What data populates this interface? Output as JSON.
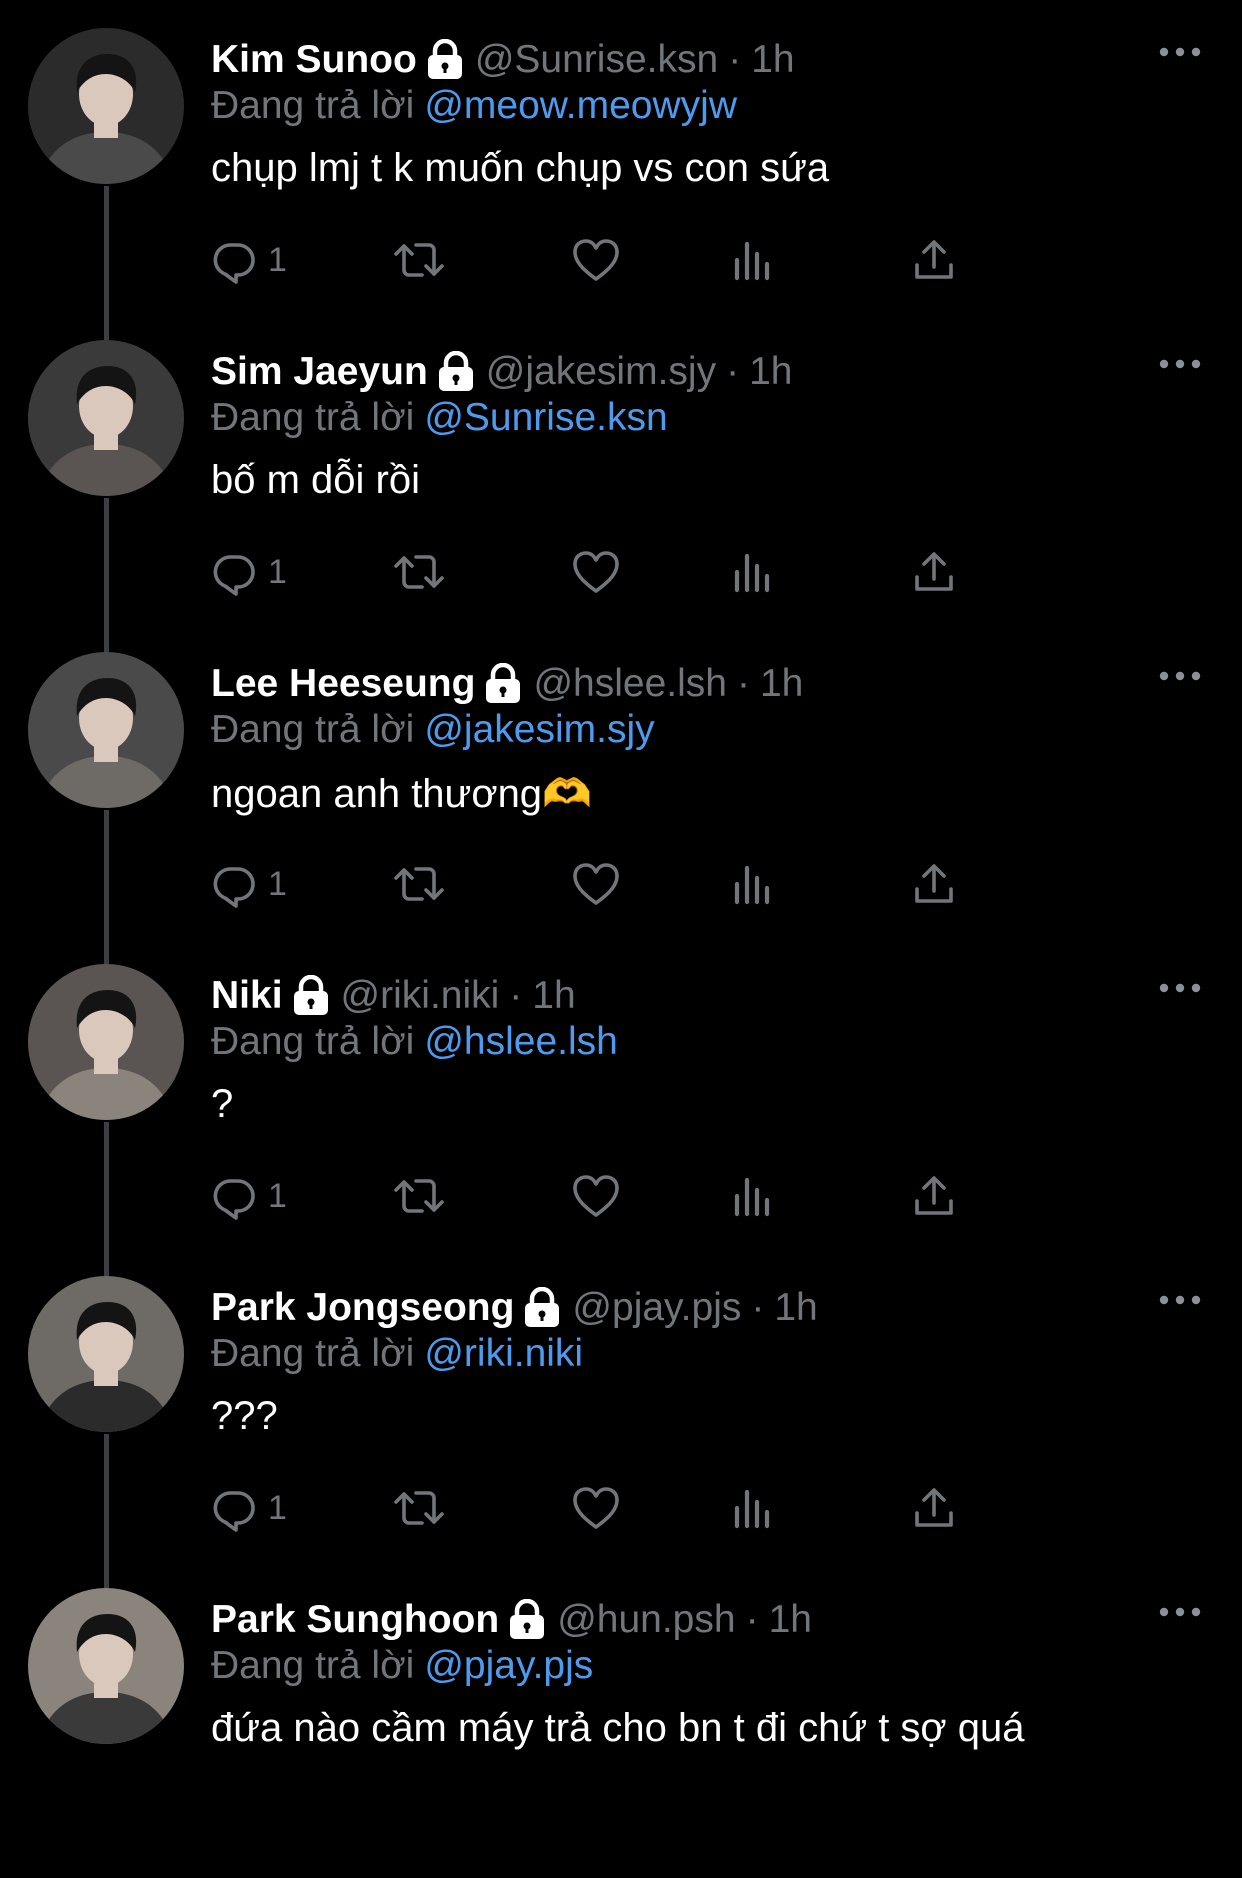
{
  "tweets": [
    {
      "name": "Kim Sunoo",
      "handle": "@Sunrise.ksn",
      "time": "1h",
      "reply_label": "Đang trả lời",
      "reply_to": "@meow.meowyjw",
      "text": "chụp lmj t k muốn chụp vs con sứa",
      "reply_count": "1"
    },
    {
      "name": "Sim Jaeyun",
      "handle": "@jakesim.sjy",
      "time": "1h",
      "reply_label": "Đang trả lời",
      "reply_to": "@Sunrise.ksn",
      "text": "bố m dỗi rồi",
      "reply_count": "1"
    },
    {
      "name": "Lee Heeseung",
      "handle": "@hslee.lsh",
      "time": "1h",
      "reply_label": "Đang trả lời",
      "reply_to": "@jakesim.sjy",
      "text": "ngoan anh thương🫶",
      "reply_count": "1"
    },
    {
      "name": "Niki",
      "handle": "@riki.niki",
      "time": "1h",
      "reply_label": "Đang trả lời",
      "reply_to": "@hslee.lsh",
      "text": "?",
      "reply_count": "1"
    },
    {
      "name": "Park Jongseong",
      "handle": "@pjay.pjs",
      "time": "1h",
      "reply_label": "Đang trả lời",
      "reply_to": "@riki.niki",
      "text": "???",
      "reply_count": "1"
    },
    {
      "name": "Park Sunghoon",
      "handle": "@hun.psh",
      "time": "1h",
      "reply_label": "Đang trả lời",
      "reply_to": "@pjay.pjs",
      "text": "đứa nào cầm máy trả cho bn t đi chứ t sợ quá",
      "reply_count": ""
    }
  ],
  "separator": "·",
  "icons": {
    "lock": "lock-icon",
    "more": "more-icon",
    "reply": "reply-icon",
    "retweet": "retweet-icon",
    "like": "like-icon",
    "views": "views-icon",
    "share": "share-icon"
  },
  "colors": {
    "background": "#000000",
    "text": "#ffffff",
    "secondary": "#71767b",
    "mention": "#4d9bef",
    "thread_line": "#3a3f44"
  },
  "avatar_palette": [
    "#2b2b2b",
    "#3a3a3a",
    "#4a4a4a",
    "#5a5553",
    "#6e6a66",
    "#8a847d"
  ]
}
